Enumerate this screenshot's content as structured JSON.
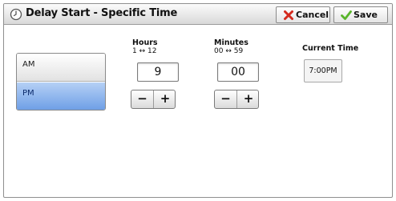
{
  "header": {
    "title": "Delay Start - Specific Time",
    "title_icon": "clock-icon",
    "cancel_label": "Cancel",
    "cancel_icon": "x-icon",
    "save_label": "Save",
    "save_icon": "checkmark-icon"
  },
  "ampm": {
    "options": [
      {
        "label": "AM",
        "selected": false
      },
      {
        "label": "PM",
        "selected": true
      }
    ]
  },
  "hours": {
    "label": "Hours",
    "range": "1 ↔ 12",
    "value": "9",
    "minus_label": "−",
    "plus_label": "+"
  },
  "minutes": {
    "label": "Minutes",
    "range": "00 ↔ 59",
    "value": "00",
    "minus_label": "−",
    "plus_label": "+"
  },
  "current_time": {
    "label": "Current Time",
    "value": "7:00PM"
  },
  "colors": {
    "selected_option": "#6d9ee6",
    "cancel_icon": "#d42a1e",
    "save_icon": "#59b52b"
  }
}
